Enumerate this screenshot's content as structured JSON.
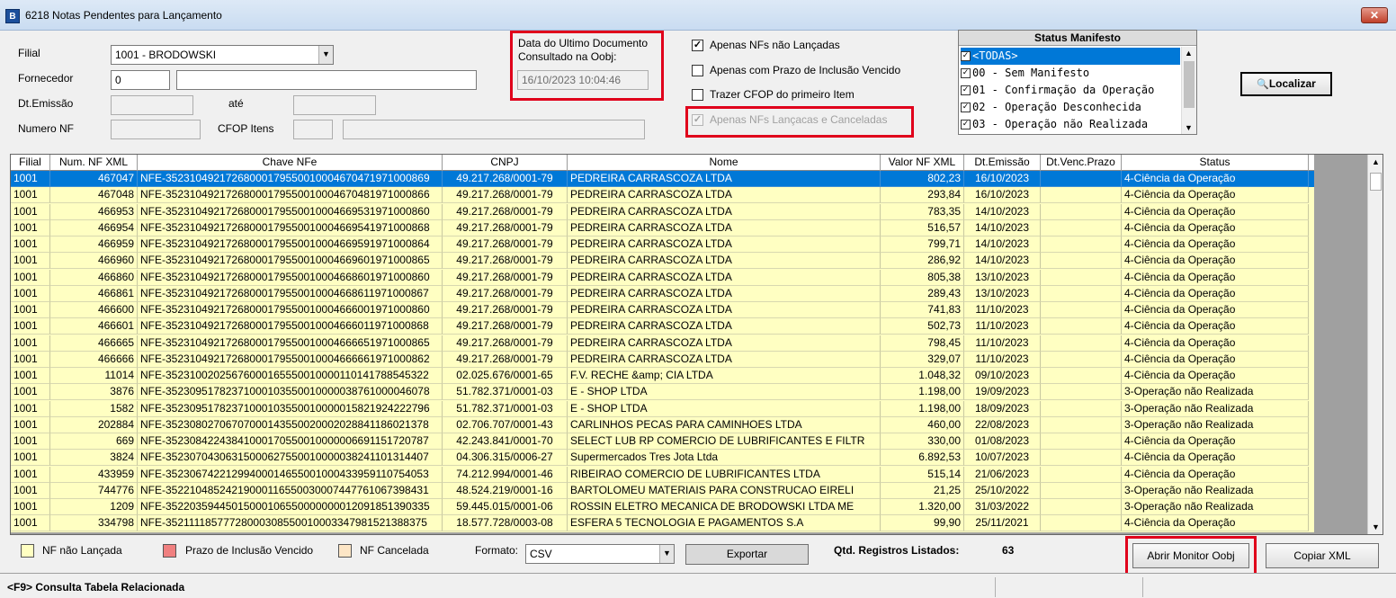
{
  "window": {
    "title": "6218 Notas Pendentes para Lançamento",
    "icon_text": "B",
    "close_glyph": "✕"
  },
  "filters": {
    "filial_label": "Filial",
    "filial_value": "1001 - BRODOWSKI",
    "fornecedor_label": "Fornecedor",
    "fornecedor_code": "0",
    "fornecedor_name": "",
    "dt_emissao_label": "Dt.Emissão",
    "dt_emissao_from": "",
    "ate_label": "até",
    "dt_emissao_to": "",
    "numero_nf_label": "Numero NF",
    "numero_nf_value": "",
    "cfop_label": "CFOP Itens",
    "cfop_value": "",
    "cfop_desc": ""
  },
  "ultimo_doc": {
    "label_line1": "Data do Ultimo Documento",
    "label_line2": "Consultado na Oobj:",
    "value": "16/10/2023 10:04:46"
  },
  "options": [
    {
      "label": "Apenas NFs não Lançadas",
      "checked": true,
      "enabled": true
    },
    {
      "label": "Apenas com Prazo de Inclusão Vencido",
      "checked": false,
      "enabled": true
    },
    {
      "label": "Trazer CFOP do primeiro Item",
      "checked": false,
      "enabled": true
    },
    {
      "label": "Apenas NFs Lançacas e Canceladas",
      "checked": true,
      "enabled": false
    }
  ],
  "status_manifesto": {
    "title": "Status Manifesto",
    "items": [
      {
        "label": "<TODAS>",
        "checked": true,
        "selected": true
      },
      {
        "label": "00 - Sem Manifesto",
        "checked": true,
        "selected": false
      },
      {
        "label": "01 - Confirmação da Operação",
        "checked": true,
        "selected": false
      },
      {
        "label": "02 - Operação Desconhecida",
        "checked": true,
        "selected": false
      },
      {
        "label": "03 - Operação não Realizada",
        "checked": true,
        "selected": false
      }
    ]
  },
  "buttons": {
    "localizar": "Localizar",
    "exportar": "Exportar",
    "abrir_monitor": "Abrir Monitor Oobj",
    "copiar_xml": "Copiar XML"
  },
  "grid": {
    "columns": [
      "Filial",
      "Num. NF XML",
      "Chave NFe",
      "CNPJ",
      "Nome",
      "Valor NF XML",
      "Dt.Emissão",
      "Dt.Venc.Prazo",
      "Status"
    ],
    "rows": [
      [
        "1001",
        "467047",
        "NFE-35231049217268000179550010004670471971000869",
        "49.217.268/0001-79",
        "PEDREIRA CARRASCOZA LTDA",
        "802,23",
        "16/10/2023",
        "",
        "4-Ciência da Operação"
      ],
      [
        "1001",
        "467048",
        "NFE-35231049217268000179550010004670481971000866",
        "49.217.268/0001-79",
        "PEDREIRA CARRASCOZA LTDA",
        "293,84",
        "16/10/2023",
        "",
        "4-Ciência da Operação"
      ],
      [
        "1001",
        "466953",
        "NFE-35231049217268000179550010004669531971000860",
        "49.217.268/0001-79",
        "PEDREIRA CARRASCOZA LTDA",
        "783,35",
        "14/10/2023",
        "",
        "4-Ciência da Operação"
      ],
      [
        "1001",
        "466954",
        "NFE-35231049217268000179550010004669541971000868",
        "49.217.268/0001-79",
        "PEDREIRA CARRASCOZA LTDA",
        "516,57",
        "14/10/2023",
        "",
        "4-Ciência da Operação"
      ],
      [
        "1001",
        "466959",
        "NFE-35231049217268000179550010004669591971000864",
        "49.217.268/0001-79",
        "PEDREIRA CARRASCOZA LTDA",
        "799,71",
        "14/10/2023",
        "",
        "4-Ciência da Operação"
      ],
      [
        "1001",
        "466960",
        "NFE-35231049217268000179550010004669601971000865",
        "49.217.268/0001-79",
        "PEDREIRA CARRASCOZA LTDA",
        "286,92",
        "14/10/2023",
        "",
        "4-Ciência da Operação"
      ],
      [
        "1001",
        "466860",
        "NFE-35231049217268000179550010004668601971000860",
        "49.217.268/0001-79",
        "PEDREIRA CARRASCOZA LTDA",
        "805,38",
        "13/10/2023",
        "",
        "4-Ciência da Operação"
      ],
      [
        "1001",
        "466861",
        "NFE-35231049217268000179550010004668611971000867",
        "49.217.268/0001-79",
        "PEDREIRA CARRASCOZA LTDA",
        "289,43",
        "13/10/2023",
        "",
        "4-Ciência da Operação"
      ],
      [
        "1001",
        "466600",
        "NFE-35231049217268000179550010004666001971000860",
        "49.217.268/0001-79",
        "PEDREIRA CARRASCOZA LTDA",
        "741,83",
        "11/10/2023",
        "",
        "4-Ciência da Operação"
      ],
      [
        "1001",
        "466601",
        "NFE-35231049217268000179550010004666011971000868",
        "49.217.268/0001-79",
        "PEDREIRA CARRASCOZA LTDA",
        "502,73",
        "11/10/2023",
        "",
        "4-Ciência da Operação"
      ],
      [
        "1001",
        "466665",
        "NFE-35231049217268000179550010004666651971000865",
        "49.217.268/0001-79",
        "PEDREIRA CARRASCOZA LTDA",
        "798,45",
        "11/10/2023",
        "",
        "4-Ciência da Operação"
      ],
      [
        "1001",
        "466666",
        "NFE-35231049217268000179550010004666661971000862",
        "49.217.268/0001-79",
        "PEDREIRA CARRASCOZA LTDA",
        "329,07",
        "11/10/2023",
        "",
        "4-Ciência da Operação"
      ],
      [
        "1001",
        "11014",
        "NFE-35231002025676000165550010000110141788545322",
        "02.025.676/0001-65",
        "F.V. RECHE &amp; CIA LTDA",
        "1.048,32",
        "09/10/2023",
        "",
        "4-Ciência da Operação"
      ],
      [
        "1001",
        "3876",
        "NFE-35230951782371000103550010000038761000046078",
        "51.782.371/0001-03",
        "E - SHOP LTDA",
        "1.198,00",
        "19/09/2023",
        "",
        "3-Operação não Realizada"
      ],
      [
        "1001",
        "1582",
        "NFE-35230951782371000103550010000015821924222796",
        "51.782.371/0001-03",
        "E - SHOP LTDA",
        "1.198,00",
        "18/09/2023",
        "",
        "3-Operação não Realizada"
      ],
      [
        "1001",
        "202884",
        "NFE-35230802706707000143550020002028841186021378",
        "02.706.707/0001-43",
        "CARLINHOS PECAS PARA CAMINHOES LTDA",
        "460,00",
        "22/08/2023",
        "",
        "3-Operação não Realizada"
      ],
      [
        "1001",
        "669",
        "NFE-35230842243841000170550010000006691151720787",
        "42.243.841/0001-70",
        "SELECT LUB RP COMERCIO DE LUBRIFICANTES E FILTR",
        "330,00",
        "01/08/2023",
        "",
        "4-Ciência da Operação"
      ],
      [
        "1001",
        "3824",
        "NFE-35230704306315000627550010000038241101314407",
        "04.306.315/0006-27",
        "Supermercados Tres Jota Ltda",
        "6.892,53",
        "10/07/2023",
        "",
        "4-Ciência da Operação"
      ],
      [
        "1001",
        "433959",
        "NFE-35230674221299400014655001000433959110754053",
        "74.212.994/0001-46",
        "RIBEIRAO COMERCIO DE LUBRIFICANTES LTDA",
        "515,14",
        "21/06/2023",
        "",
        "4-Ciência da Operação"
      ],
      [
        "1001",
        "744776",
        "NFE-35221048524219000116550030007447761067398431",
        "48.524.219/0001-16",
        "BARTOLOMEU MATERIAIS PARA CONSTRUCAO EIRELI",
        "21,25",
        "25/10/2022",
        "",
        "3-Operação não Realizada"
      ],
      [
        "1001",
        "1209",
        "NFE-35220359445015000106550000000012091851390335",
        "59.445.015/0001-06",
        "ROSSIN ELETRO MECANICA DE BRODOWSKI LTDA ME",
        "1.320,00",
        "31/03/2022",
        "",
        "3-Operação não Realizada"
      ],
      [
        "1001",
        "334798",
        "NFE-35211118577728000308550010003347981521388375",
        "18.577.728/0003-08",
        "ESFERA 5 TECNOLOGIA E PAGAMENTOS S.A",
        "99,90",
        "25/11/2021",
        "",
        "4-Ciência da Operação"
      ]
    ]
  },
  "legend": [
    {
      "label": "NF não Lançada",
      "color": "#ffffc2"
    },
    {
      "label": "Prazo de Inclusão Vencido",
      "color": "#f08080"
    },
    {
      "label": "NF Cancelada",
      "color": "#fde6c6"
    }
  ],
  "formato": {
    "label": "Formato:",
    "value": "CSV"
  },
  "qtd": {
    "label": "Qtd. Registros Listados:",
    "value": "63"
  },
  "status_bar": {
    "text": "<F9> Consulta Tabela Relacionada"
  },
  "colors": {
    "row_bg": "#ffffc2",
    "selected_bg": "#0078d7",
    "highlight_red": "#e0001b"
  }
}
